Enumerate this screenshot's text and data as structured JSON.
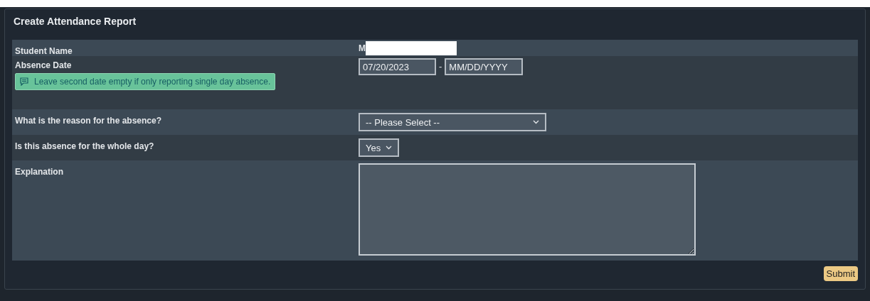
{
  "panel": {
    "title": "Create Attendance Report"
  },
  "rows": [
    {
      "kind": "text",
      "label": "Student Name",
      "value": "M",
      "redacted": true
    },
    {
      "kind": "dates",
      "label": "Absence Date",
      "start": "07/20/2023",
      "separator": "-",
      "end_placeholder": "MM/DD/YYYY",
      "hint": "Leave second date empty if only reporting single day absence."
    },
    {
      "kind": "long-select",
      "label": "What is the reason for the absence?",
      "value": "-- Please Select --"
    },
    {
      "kind": "short-select",
      "label": "Is this absence for the whole day?",
      "value": "Yes"
    },
    {
      "kind": "textarea",
      "label": "Explanation"
    }
  ],
  "submit": "Submit"
}
